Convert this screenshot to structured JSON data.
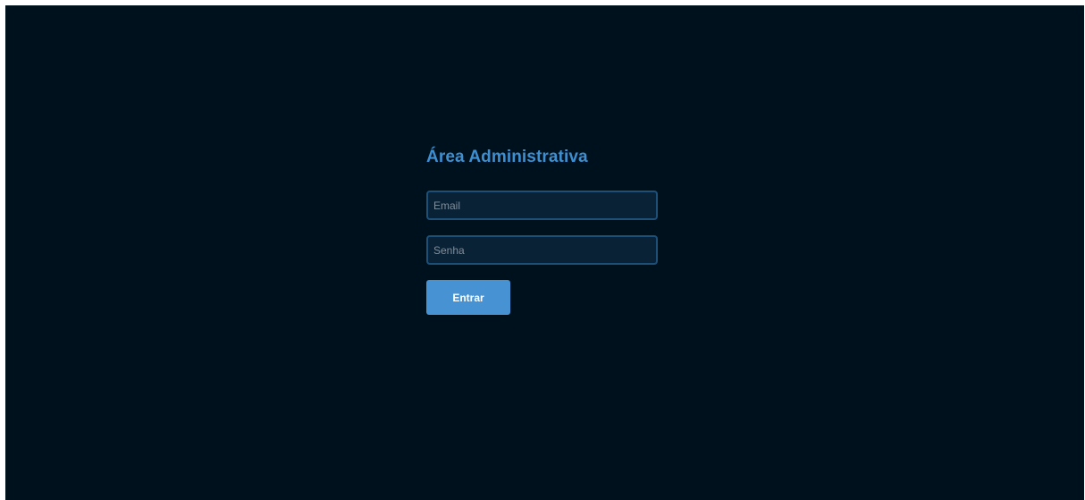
{
  "login": {
    "title": "Área Administrativa",
    "email_placeholder": "Email",
    "email_value": "",
    "password_placeholder": "Senha",
    "password_value": "",
    "submit_label": "Entrar"
  },
  "colors": {
    "background": "#00111e",
    "accent": "#3d8fd1",
    "button": "#4792d2",
    "input_background": "#0a2236",
    "input_border": "#1e4f76"
  }
}
